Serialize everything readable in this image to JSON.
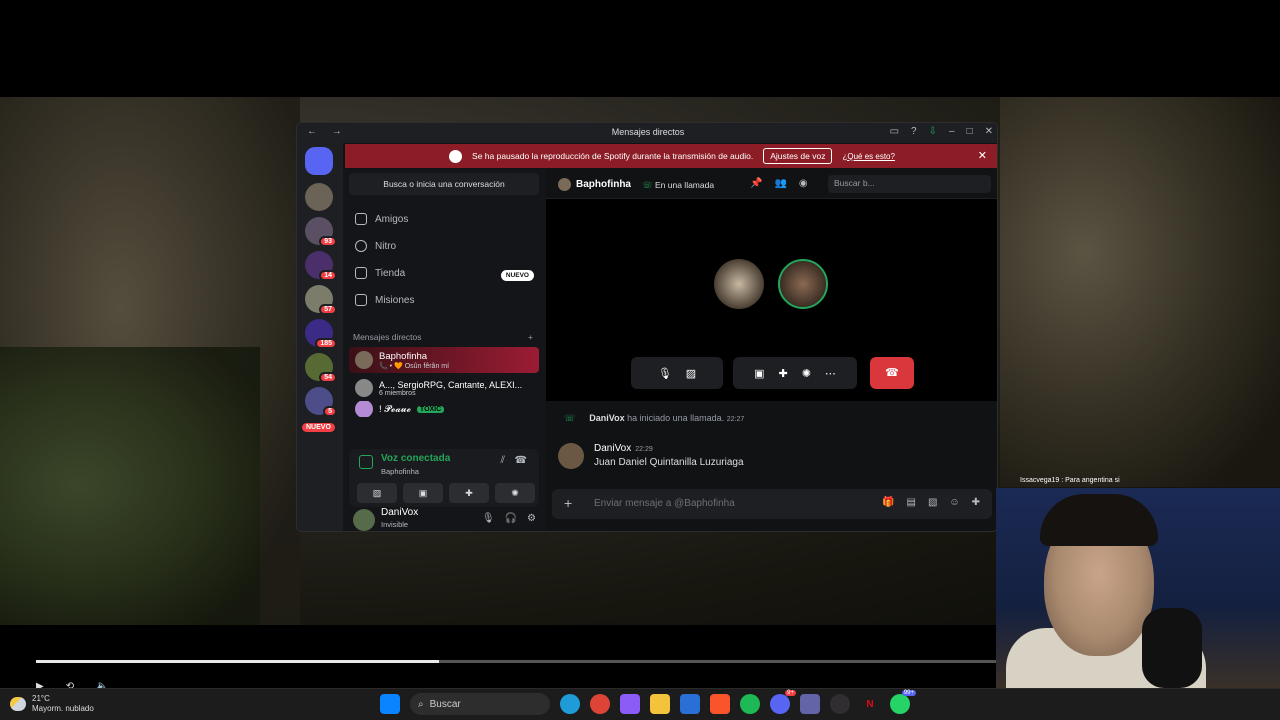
{
  "window": {
    "title": "Mensajes directos",
    "nav": "← →"
  },
  "servers": {
    "badges": [
      "93",
      "14",
      "57",
      "185",
      "54",
      "5"
    ],
    "new_label": "NUEVO"
  },
  "notice": {
    "text": "Se ha pausado la reproducción de Spotify durante la transmisión de audio.",
    "button": "Ajustes de voz",
    "link": "¿Qué es esto?"
  },
  "dm": {
    "search": "Busca o inicia una conversación",
    "nav": [
      "Amigos",
      "Nitro",
      "Tienda",
      "Misiones"
    ],
    "store_badge": "NUEVO",
    "header": "Mensajes directos",
    "add": "+",
    "items": [
      {
        "name": "Baphofinha",
        "sub": "📞 • 🧡 Osûn fêrân mí"
      },
      {
        "name": "A..., SergioRPG, Cantante, ALEXI...",
        "sub": "6 miembros"
      },
      {
        "name": "! 𝓟𝓮𝓪𝓾𝓮",
        "sub": "TOXIC"
      }
    ]
  },
  "voice": {
    "status": "Voz conectada",
    "channel": "Baphofinha"
  },
  "user": {
    "name": "DaniVox",
    "status": "Invisible"
  },
  "chat": {
    "name": "Baphofinha",
    "status": "En una llamada",
    "search_placeholder": "Buscar b...",
    "system_user": "DaniVox",
    "system_text": "ha iniciado una llamada.",
    "system_time": "22:27",
    "msg_user": "DaniVox",
    "msg_time": "22:29",
    "msg_text": "Juan Daniel Quintanilla Luzuriaga",
    "composer_placeholder": "Enviar mensaje a @Baphofinha"
  },
  "taskbar": {
    "temp": "21°C",
    "weather": "Mayorm. nublado",
    "search": "Buscar",
    "whatsapp_badge": "99+",
    "discord_badge": "9+"
  },
  "stream_overlay": "Issacvega19 : Para angentina si",
  "video": {
    "progress": 0.42
  },
  "colors": {
    "notice": "#8c1c26",
    "green": "#23a55a",
    "hangup": "#da373c",
    "blurple": "#5865f2"
  }
}
